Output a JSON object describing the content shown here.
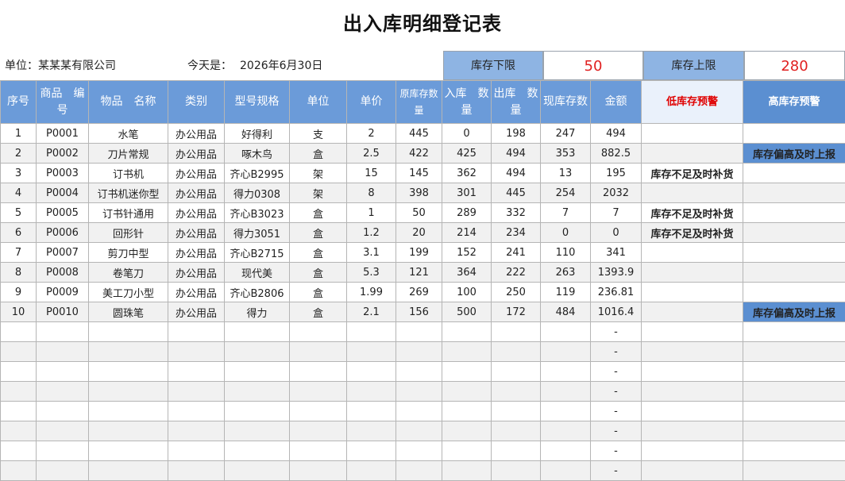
{
  "title": "出入库明细登记表",
  "unit_label": "单位：",
  "unit_value": "某某某有限公司",
  "date_label": "今天是：",
  "date_value": "2026年6月30日",
  "limits": {
    "lower_label": "库存下限",
    "lower_value": "50",
    "upper_label": "库存上限",
    "upper_value": "280"
  },
  "headers": [
    "序号",
    "商品　编号",
    "物品　名称",
    "类别",
    "型号规格",
    "单位",
    "单价",
    "原库存数量",
    "入库　数量",
    "出库　数量",
    "现库存数",
    "金额",
    "低库存预警",
    "高库存预警"
  ],
  "rows": [
    [
      "1",
      "P0001",
      "水笔",
      "办公用品",
      "好得利",
      "支",
      "2",
      "445",
      "0",
      "198",
      "247",
      "494",
      "",
      ""
    ],
    [
      "2",
      "P0002",
      "刀片常规",
      "办公用品",
      "啄木鸟",
      "盒",
      "2.5",
      "422",
      "425",
      "494",
      "353",
      "882.5",
      "",
      "库存偏高及时上报"
    ],
    [
      "3",
      "P0003",
      "订书机",
      "办公用品",
      "齐心B2995",
      "架",
      "15",
      "145",
      "362",
      "494",
      "13",
      "195",
      "库存不足及时补货",
      ""
    ],
    [
      "4",
      "P0004",
      "订书机迷你型",
      "办公用品",
      "得力0308",
      "架",
      "8",
      "398",
      "301",
      "445",
      "254",
      "2032",
      "",
      ""
    ],
    [
      "5",
      "P0005",
      "订书针通用",
      "办公用品",
      "齐心B3023",
      "盒",
      "1",
      "50",
      "289",
      "332",
      "7",
      "7",
      "库存不足及时补货",
      ""
    ],
    [
      "6",
      "P0006",
      "回形针",
      "办公用品",
      "得力3051",
      "盒",
      "1.2",
      "20",
      "214",
      "234",
      "0",
      "0",
      "库存不足及时补货",
      ""
    ],
    [
      "7",
      "P0007",
      "剪刀中型",
      "办公用品",
      "齐心B2715",
      "盒",
      "3.1",
      "199",
      "152",
      "241",
      "110",
      "341",
      "",
      ""
    ],
    [
      "8",
      "P0008",
      "卷笔刀",
      "办公用品",
      "现代美",
      "盒",
      "5.3",
      "121",
      "364",
      "222",
      "263",
      "1393.9",
      "",
      ""
    ],
    [
      "9",
      "P0009",
      "美工刀小型",
      "办公用品",
      "齐心B2806",
      "盒",
      "1.99",
      "269",
      "100",
      "250",
      "119",
      "236.81",
      "",
      ""
    ],
    [
      "10",
      "P0010",
      "圆珠笔",
      "办公用品",
      "得力",
      "盒",
      "2.1",
      "156",
      "500",
      "172",
      "484",
      "1016.4",
      "",
      "库存偏高及时上报"
    ]
  ],
  "empty_amount_placeholder": "-",
  "empty_row_count": 8,
  "colors": {
    "header_bg": "#6b9bd9",
    "limit_label_bg": "#8eb4e3",
    "warning_red": "#e00000",
    "high_warning_bg": "#5b8fd1",
    "alt_row_bg": "#f1f1f1"
  }
}
